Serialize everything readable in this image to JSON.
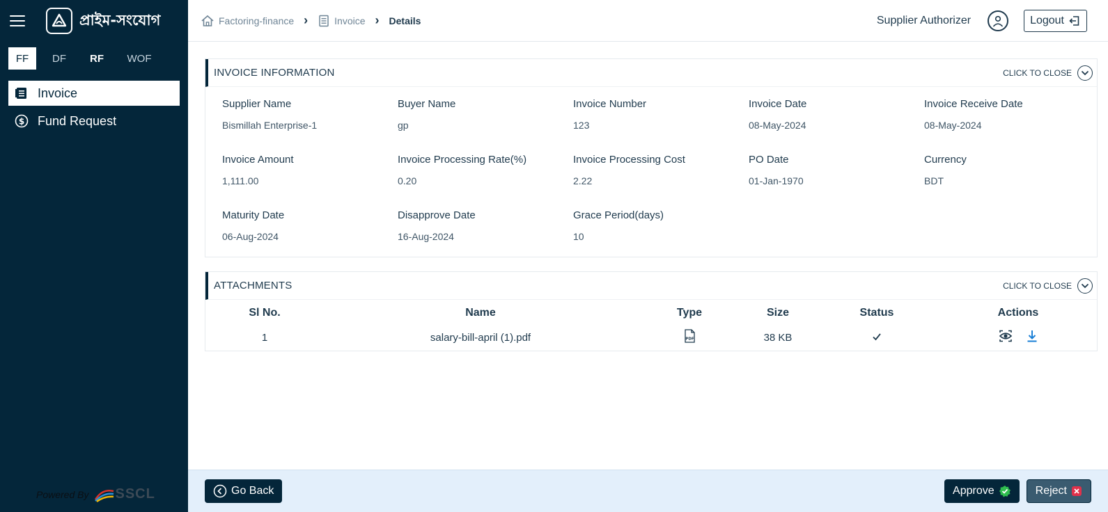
{
  "app": {
    "title": "প্রাইম-সংযোগ"
  },
  "sidebar": {
    "tabs": [
      {
        "label": "FF"
      },
      {
        "label": "DF"
      },
      {
        "label": "RF"
      },
      {
        "label": "WOF"
      }
    ],
    "items": [
      {
        "label": "Invoice",
        "icon": "invoice-icon"
      },
      {
        "label": "Fund Request",
        "icon": "dollar-circle-icon"
      }
    ],
    "powered_by": "Powered By",
    "brand": "SSCL"
  },
  "header": {
    "breadcrumb": [
      {
        "label": "Factoring-finance"
      },
      {
        "label": "Invoice"
      },
      {
        "label": "Details"
      }
    ],
    "role": "Supplier Authorizer",
    "logout_label": "Logout"
  },
  "invoice_info": {
    "title": "INVOICE INFORMATION",
    "toggle_label": "CLICK TO CLOSE",
    "fields": [
      {
        "label": "Supplier Name",
        "value": "Bismillah Enterprise-1"
      },
      {
        "label": "Buyer Name",
        "value": "gp"
      },
      {
        "label": "Invoice Number",
        "value": "123"
      },
      {
        "label": "Invoice Date",
        "value": "08-May-2024"
      },
      {
        "label": "Invoice Receive Date",
        "value": "08-May-2024"
      },
      {
        "label": "Invoice Amount",
        "value": "1,111.00"
      },
      {
        "label": "Invoice Processing Rate(%)",
        "value": "0.20"
      },
      {
        "label": "Invoice Processing Cost",
        "value": "2.22"
      },
      {
        "label": "PO Date",
        "value": "01-Jan-1970"
      },
      {
        "label": "Currency",
        "value": "BDT"
      },
      {
        "label": "Maturity Date",
        "value": "06-Aug-2024"
      },
      {
        "label": "Disapprove Date",
        "value": "16-Aug-2024"
      },
      {
        "label": "Grace Period(days)",
        "value": "10"
      }
    ]
  },
  "attachments": {
    "title": "ATTACHMENTS",
    "toggle_label": "CLICK TO CLOSE",
    "columns": [
      "Sl No.",
      "Name",
      "Type",
      "Size",
      "Status",
      "Actions"
    ],
    "rows": [
      {
        "sl": "1",
        "name": "salary-bill-april (1).pdf",
        "type_icon": "pdf-icon",
        "size": "38 KB",
        "status_icon": "checkmark-icon"
      }
    ]
  },
  "footer": {
    "back_label": "Go Back",
    "approve_label": "Approve",
    "reject_label": "Reject"
  },
  "colors": {
    "sidebar_bg": "#04263a",
    "footer_bg": "#e3effb",
    "approve_check": "#2fbf4f",
    "reject_x": "#e0314b",
    "download": "#1a7fd6"
  }
}
